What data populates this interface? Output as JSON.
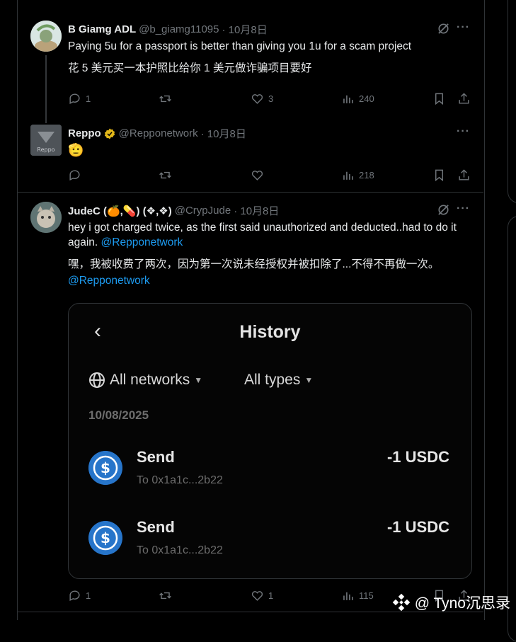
{
  "tweets": [
    {
      "name": "B Giamg ADL",
      "handle": "@b_giamg11095",
      "date": "· 10月8日",
      "text_en": "Paying 5u for a passport is better than giving you 1u for a scam project",
      "text_zh": "花 5 美元买一本护照比给你 1 美元做诈骗项目要好",
      "replies": "1",
      "retweets": "",
      "likes": "3",
      "views": "240"
    },
    {
      "name": "Reppo",
      "handle": "@Repponetwork",
      "date": "· 10月8日",
      "avatar_text": "Reppo",
      "text": "🫡",
      "replies": "",
      "retweets": "",
      "likes": "",
      "views": "218"
    },
    {
      "name": "JudeC (🍊,💊) (❖,❖)",
      "handle": "@CrypJude",
      "date": "· 10月8日",
      "text_en": "hey i got charged twice, as the first said unauthorized and deducted..had to do it again. ",
      "mention": "@Repponetwork",
      "text_zh": "嘿，我被收费了两次，因为第一次说未经授权并被扣除了...不得不再做一次。",
      "mention2": "@Repponetwork",
      "replies": "1",
      "retweets": "",
      "likes": "1",
      "views": "115"
    }
  ],
  "embedded": {
    "back": "‹",
    "title": "History",
    "filter_networks": "All networks",
    "filter_types": "All types",
    "date": "10/08/2025",
    "transactions": [
      {
        "type": "Send",
        "to": "To 0x1a1c...2b22",
        "amount": "-1 USDC"
      },
      {
        "type": "Send",
        "to": "To 0x1a1c...2b22",
        "amount": "-1 USDC"
      }
    ]
  },
  "watermark": "@ Tyno沉思录",
  "colors": {
    "accent": "#1d9bf0",
    "usdc": "#2775ca",
    "verified": "#e2b719"
  }
}
